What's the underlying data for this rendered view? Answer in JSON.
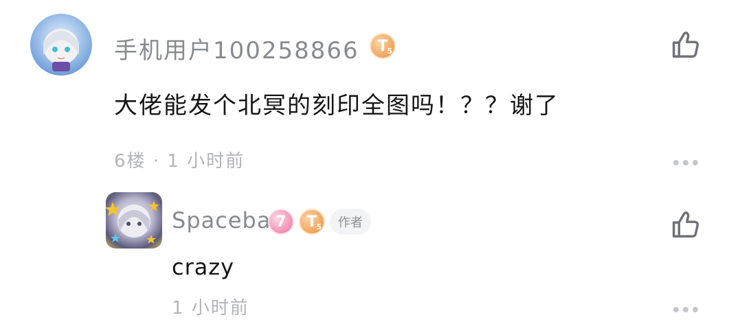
{
  "comment": {
    "username": "手机用户100258866",
    "badge_t": "T",
    "badge_t_level": "5",
    "text": "大佬能发个北冥的刻印全图吗！？？谢了",
    "meta": "6楼 · 1 小时前"
  },
  "reply": {
    "username": "Spacebar",
    "badge_level": "7",
    "badge_t": "T",
    "badge_t_level": "5",
    "author_tag": "作者",
    "text": "crazy",
    "meta": "1 小时前"
  },
  "icons": {
    "like": "thumbs-up-icon",
    "more": "more-horizontal-icon"
  },
  "colors": {
    "username": "#888a90",
    "meta": "#b3b4b8",
    "badge_t": "#f0a45c",
    "badge_level": "#f48eb3",
    "icon": "#6f7177"
  }
}
